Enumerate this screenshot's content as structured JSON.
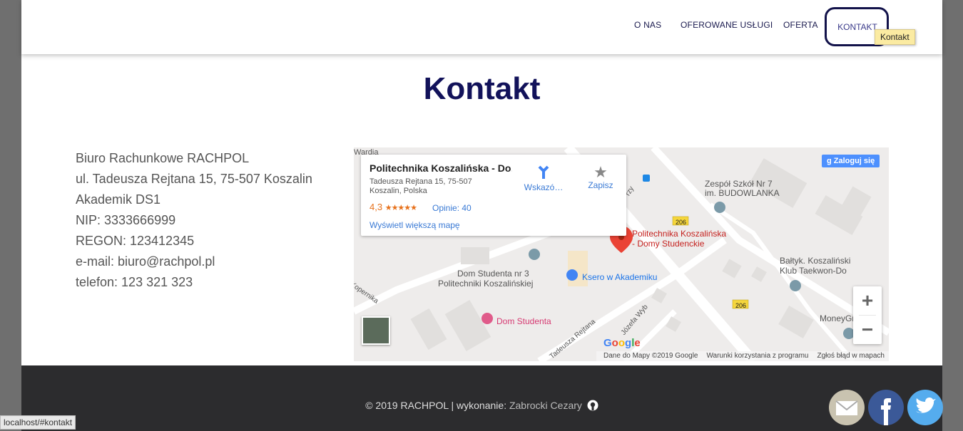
{
  "nav": {
    "items": [
      "O NAS",
      "OFEROWANE USŁUGI",
      "OFERTA"
    ],
    "active": "KONTAKT",
    "tooltip": "Kontakt"
  },
  "page_title": "Kontakt",
  "contact_lines": [
    "Biuro Rachunkowe RACHPOL",
    "ul. Tadeusza Rejtana 15, 75-507 Koszalin",
    "Akademik DS1",
    "NIP: 3333666999",
    "REGON: 123412345",
    "e-mail: biuro@rachpol.pl",
    "telefon: 123 321 323"
  ],
  "map": {
    "info_title": "Politechnika Koszalińska - Do…",
    "info_address_1": "Tadeusza Rejtana 15, 75-507",
    "info_address_2": "Koszalin, Polska",
    "rating": "4,3",
    "stars": "★★★★★",
    "reviews": "Opinie: 40",
    "larger_map_link": "Wyświetl większą mapę",
    "directions_label": "Wskazó…",
    "save_label": "Zapisz",
    "signin_label": "Zaloguj się",
    "google_logo": "Google",
    "footer_data": "Dane do Mapy ©2019 Google",
    "footer_terms": "Warunki korzystania z programu",
    "footer_report": "Zgłoś błąd w mapach",
    "zoom_in": "+",
    "zoom_out": "−",
    "labels": {
      "wardia": "Wardia",
      "zespol": "Zespół Szkół Nr 7",
      "zespol2": "im. BUDOWLANKA",
      "politechnika": "Politechnika Koszalińska",
      "politechnika2": "- Domy Studenckie",
      "dom_nr3": "Dom Studenta nr 3",
      "dom_nr3b": "Politechniki Koszalińskiej",
      "ksero": "Ksero w Akademiku",
      "baltyk": "Bałtyk. Koszaliński",
      "baltyk2": "Klub Taekwon-Do",
      "moneygram": "MoneyGram",
      "dom_studenta": "Dom Studenta",
      "kopernika": "Kopernika",
      "rejtana": "Tadeusza Rejtana",
      "jozefa": "Józefa Wyb",
      "road206a": "206",
      "road206b": "206",
      "rzy": "rzy"
    }
  },
  "footer": {
    "copyright": "© 2019 RACHPOL | wykonanie: ",
    "author": "Zabrocki Cezary"
  },
  "statusbar": "localhost/#kontakt",
  "colors": {
    "title": "#12125a",
    "footer_bg": "#2c2c2e",
    "marker_red": "#ea4335"
  }
}
